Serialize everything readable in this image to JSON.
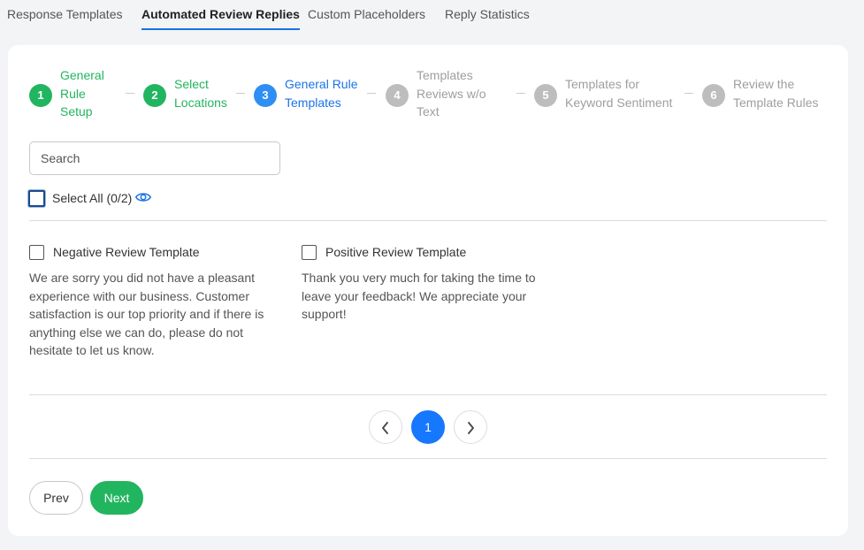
{
  "tabs": [
    {
      "label": "Response Templates"
    },
    {
      "label": "Automated Review Replies"
    },
    {
      "label": "Custom Placeholders"
    },
    {
      "label": "Reply Statistics"
    }
  ],
  "active_tab": "Automated Review Replies",
  "steps": [
    {
      "num": "1",
      "label": "General Rule Setup",
      "state": "done"
    },
    {
      "num": "2",
      "label": "Select Locations",
      "state": "done"
    },
    {
      "num": "3",
      "label": "General Rule Templates",
      "state": "current"
    },
    {
      "num": "4",
      "label": "Templates Reviews w/o Text",
      "state": "todo"
    },
    {
      "num": "5",
      "label": "Templates for Keyword Sentiment",
      "state": "todo"
    },
    {
      "num": "6",
      "label": "Review the Template Rules",
      "state": "todo"
    }
  ],
  "search": {
    "placeholder": "Search",
    "value": ""
  },
  "select_all": {
    "label": "Select All (0/2)",
    "checked": false
  },
  "templates": [
    {
      "title": "Negative Review Template",
      "checked": false,
      "body": "We are sorry you did not have a pleasant experience with our business. Customer satisfaction is our top priority and if there is anything else we can do, please do not hesitate to let us know."
    },
    {
      "title": "Positive Review Template",
      "checked": false,
      "body": "Thank you very much for taking the time to leave your feedback! We appreciate your support!"
    }
  ],
  "pagination": {
    "current_page": "1"
  },
  "buttons": {
    "prev": "Prev",
    "next": "Next"
  },
  "colors": {
    "done": "#22b55f",
    "current": "#2f8ef3",
    "todo": "#bdbdbd",
    "accent": "#1677ff"
  },
  "icons": {
    "visibility": "eye-icon",
    "prev_page": "chevron-left-icon",
    "next_page": "chevron-right-icon"
  }
}
